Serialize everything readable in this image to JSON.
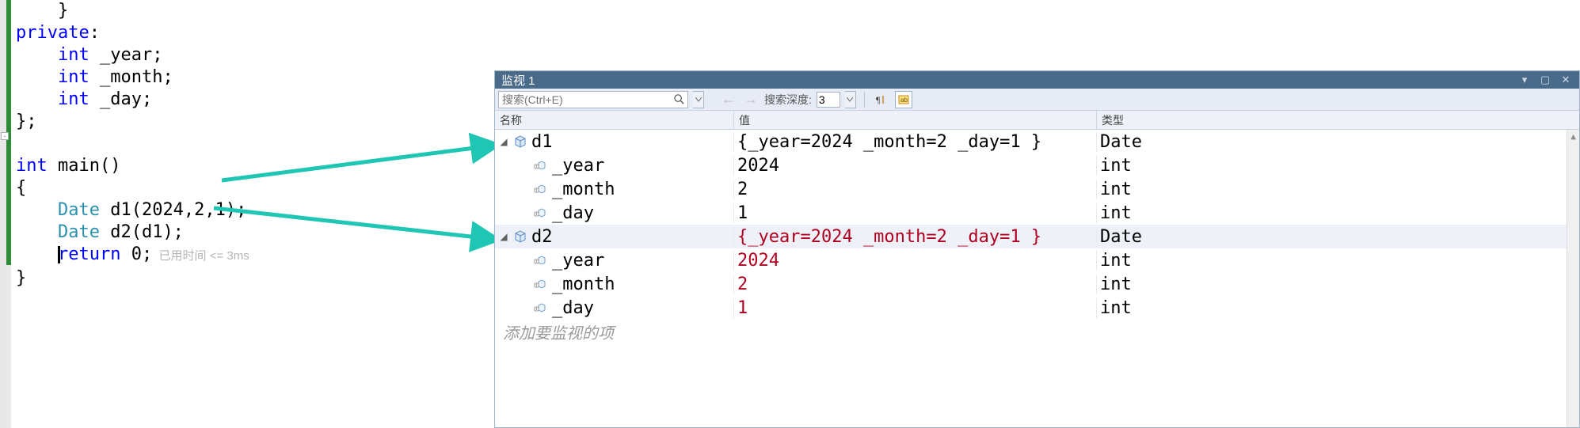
{
  "code": {
    "lines": [
      {
        "indent": "    ",
        "tokens": [
          {
            "t": "pun",
            "v": "}"
          }
        ]
      },
      {
        "indent": "",
        "tokens": [
          {
            "t": "kw",
            "v": "private"
          },
          {
            "t": "pun",
            "v": ":"
          }
        ]
      },
      {
        "indent": "    ",
        "tokens": [
          {
            "t": "kw",
            "v": "int"
          },
          {
            "t": "pun",
            "v": " "
          },
          {
            "t": "id",
            "v": "_year"
          },
          {
            "t": "pun",
            "v": ";"
          }
        ]
      },
      {
        "indent": "    ",
        "tokens": [
          {
            "t": "kw",
            "v": "int"
          },
          {
            "t": "pun",
            "v": " "
          },
          {
            "t": "id",
            "v": "_month"
          },
          {
            "t": "pun",
            "v": ";"
          }
        ]
      },
      {
        "indent": "    ",
        "tokens": [
          {
            "t": "kw",
            "v": "int"
          },
          {
            "t": "pun",
            "v": " "
          },
          {
            "t": "id",
            "v": "_day"
          },
          {
            "t": "pun",
            "v": ";"
          }
        ]
      },
      {
        "indent": "",
        "tokens": [
          {
            "t": "pun",
            "v": "};"
          }
        ]
      },
      {
        "indent": "",
        "tokens": []
      },
      {
        "indent": "",
        "tokens": [
          {
            "t": "kw",
            "v": "int"
          },
          {
            "t": "pun",
            "v": " "
          },
          {
            "t": "id",
            "v": "main"
          },
          {
            "t": "pun",
            "v": "()"
          }
        ]
      },
      {
        "indent": "",
        "tokens": [
          {
            "t": "pun",
            "v": "{"
          }
        ]
      },
      {
        "indent": "    ",
        "tokens": [
          {
            "t": "type",
            "v": "Date"
          },
          {
            "t": "pun",
            "v": " d1(2024,2,1);"
          }
        ]
      },
      {
        "indent": "    ",
        "tokens": [
          {
            "t": "type",
            "v": "Date"
          },
          {
            "t": "pun",
            "v": " d2(d1);"
          }
        ]
      },
      {
        "indent": "    ",
        "tokens": [
          {
            "t": "kw",
            "v": "return"
          },
          {
            "t": "pun",
            "v": " 0;"
          }
        ],
        "caret": true,
        "ghost": "已用时间 <= 3ms"
      },
      {
        "indent": "",
        "tokens": [
          {
            "t": "pun",
            "v": "}"
          }
        ]
      }
    ],
    "ghost_prefix": "  "
  },
  "watch": {
    "title": "监视 1",
    "search_placeholder": "搜索(Ctrl+E)",
    "depth_label": "搜索深度:",
    "depth_value": "3",
    "columns": {
      "name": "名称",
      "value": "值",
      "type": "类型"
    },
    "rows": [
      {
        "level": 0,
        "exp": "open",
        "icon": "struct",
        "name": "d1",
        "value": "{_year=2024 _month=2 _day=1 }",
        "type": "Date",
        "red": false
      },
      {
        "level": 1,
        "exp": "none",
        "icon": "field",
        "name": "_year",
        "value": "2024",
        "type": "int",
        "red": false
      },
      {
        "level": 1,
        "exp": "none",
        "icon": "field",
        "name": "_month",
        "value": "2",
        "type": "int",
        "red": false
      },
      {
        "level": 1,
        "exp": "none",
        "icon": "field",
        "name": "_day",
        "value": "1",
        "type": "int",
        "red": false
      },
      {
        "level": 0,
        "exp": "open",
        "icon": "struct",
        "name": "d2",
        "value": "{_year=2024 _month=2 _day=1 }",
        "type": "Date",
        "red": true,
        "sel": true
      },
      {
        "level": 1,
        "exp": "none",
        "icon": "field",
        "name": "_year",
        "value": "2024",
        "type": "int",
        "red": true
      },
      {
        "level": 1,
        "exp": "none",
        "icon": "field",
        "name": "_month",
        "value": "2",
        "type": "int",
        "red": true
      },
      {
        "level": 1,
        "exp": "none",
        "icon": "field",
        "name": "_day",
        "value": "1",
        "type": "int",
        "red": true
      }
    ],
    "add_item": "添加要监视的项"
  },
  "arrows": {
    "color": "#1fc6b3"
  }
}
